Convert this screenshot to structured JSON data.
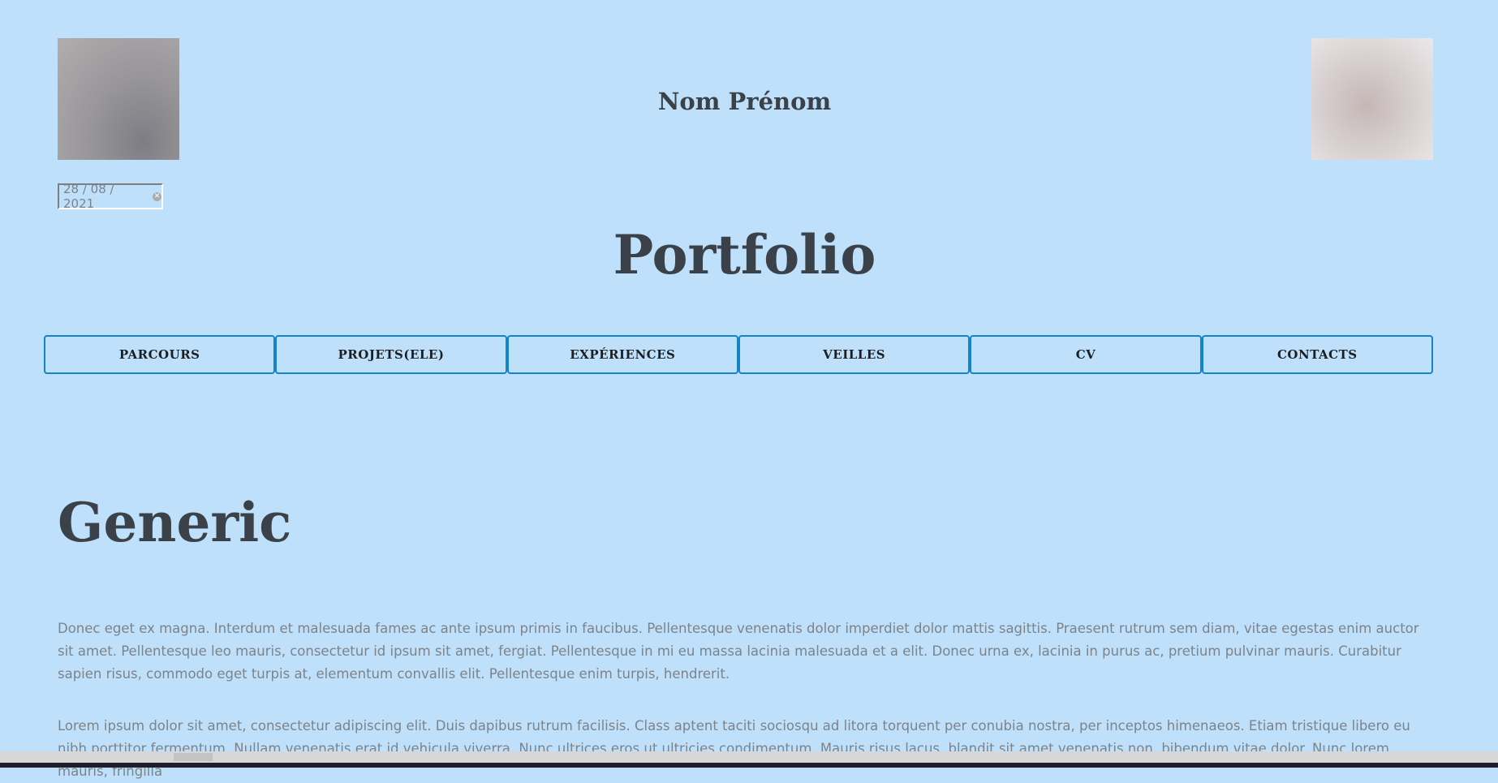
{
  "header": {
    "site_name": "Nom Prénom",
    "left_photo": "profile-photo",
    "right_photo": "profile-photo"
  },
  "date_input": {
    "value": "28 / 08 / 2021",
    "clear_icon": "clear-icon"
  },
  "page_title": "Portfolio",
  "nav": [
    {
      "label": "PARCOURS"
    },
    {
      "label": "PROJETS(ELE)"
    },
    {
      "label": "EXPÉRIENCES"
    },
    {
      "label": "VEILLES"
    },
    {
      "label": "CV"
    },
    {
      "label": "CONTACTS"
    }
  ],
  "main": {
    "title": "Generic",
    "paragraphs": [
      "Donec eget ex magna. Interdum et malesuada fames ac ante ipsum primis in faucibus. Pellentesque venenatis dolor imperdiet dolor mattis sagittis. Praesent rutrum sem diam, vitae egestas enim auctor sit amet. Pellentesque leo mauris, consectetur id ipsum sit amet, fergiat. Pellentesque in mi eu massa lacinia malesuada et a elit. Donec urna ex, lacinia in purus ac, pretium pulvinar mauris. Curabitur sapien risus, commodo eget turpis at, elementum convallis elit. Pellentesque enim turpis, hendrerit.",
      "Lorem ipsum dolor sit amet, consectetur adipiscing elit. Duis dapibus rutrum facilisis. Class aptent taciti sociosqu ad litora torquent per conubia nostra, per inceptos himenaeos. Etiam tristique libero eu nibh porttitor fermentum. Nullam venenatis erat id vehicula viverra. Nunc ultrices eros ut ultricies condimentum. Mauris risus lacus, blandit sit amet venenatis non, bibendum vitae dolor. Nunc lorem mauris, fringilla"
    ]
  },
  "colors": {
    "background": "#bee0fa",
    "heading": "#3b4148",
    "body_text": "#7d8388",
    "nav_border": "#1584c6"
  }
}
